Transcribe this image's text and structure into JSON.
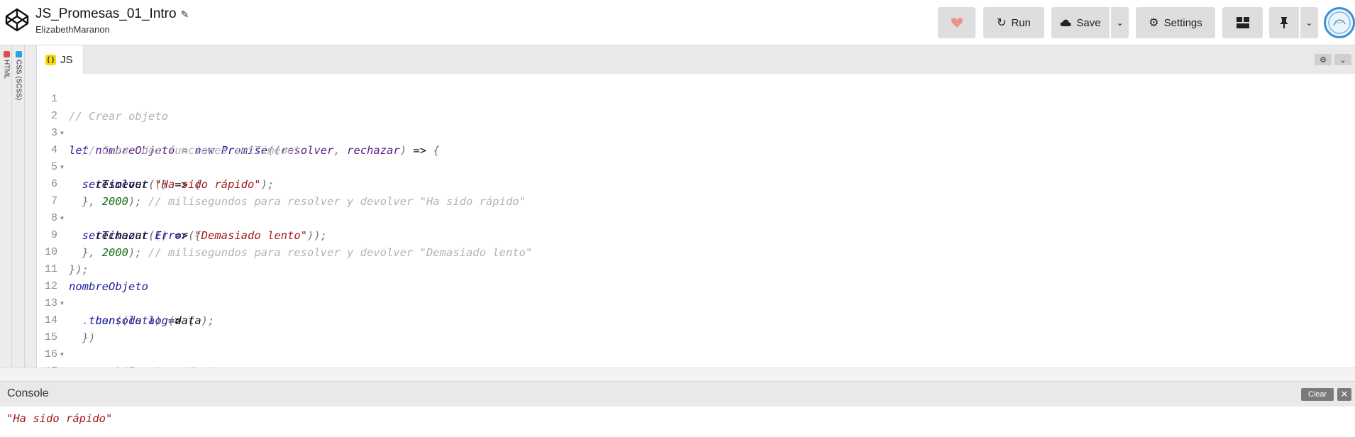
{
  "header": {
    "title": "JS_Promesas_01_Intro",
    "author": "ElizabethMaranon",
    "run_label": "Run",
    "save_label": "Save",
    "settings_label": "Settings"
  },
  "side_tabs": {
    "html_label": "HTML",
    "css_label": "CSS (SCSS)"
  },
  "editor": {
    "tab_label": "JS",
    "line_numbers": [
      "1",
      "2",
      "3",
      "4",
      "5",
      "6",
      "7",
      "8",
      "9",
      "10",
      "11",
      "12",
      "13",
      "14",
      "15",
      "16",
      "17"
    ]
  },
  "console": {
    "title": "Console",
    "clear_label": "Clear",
    "output": "\"Ha sido rápido\""
  },
  "colors": {
    "heart": "#f08f8f",
    "html_tab": "#e34c4c",
    "css_tab": "#2ba3e0",
    "js_tab": "#f5d90a"
  }
}
